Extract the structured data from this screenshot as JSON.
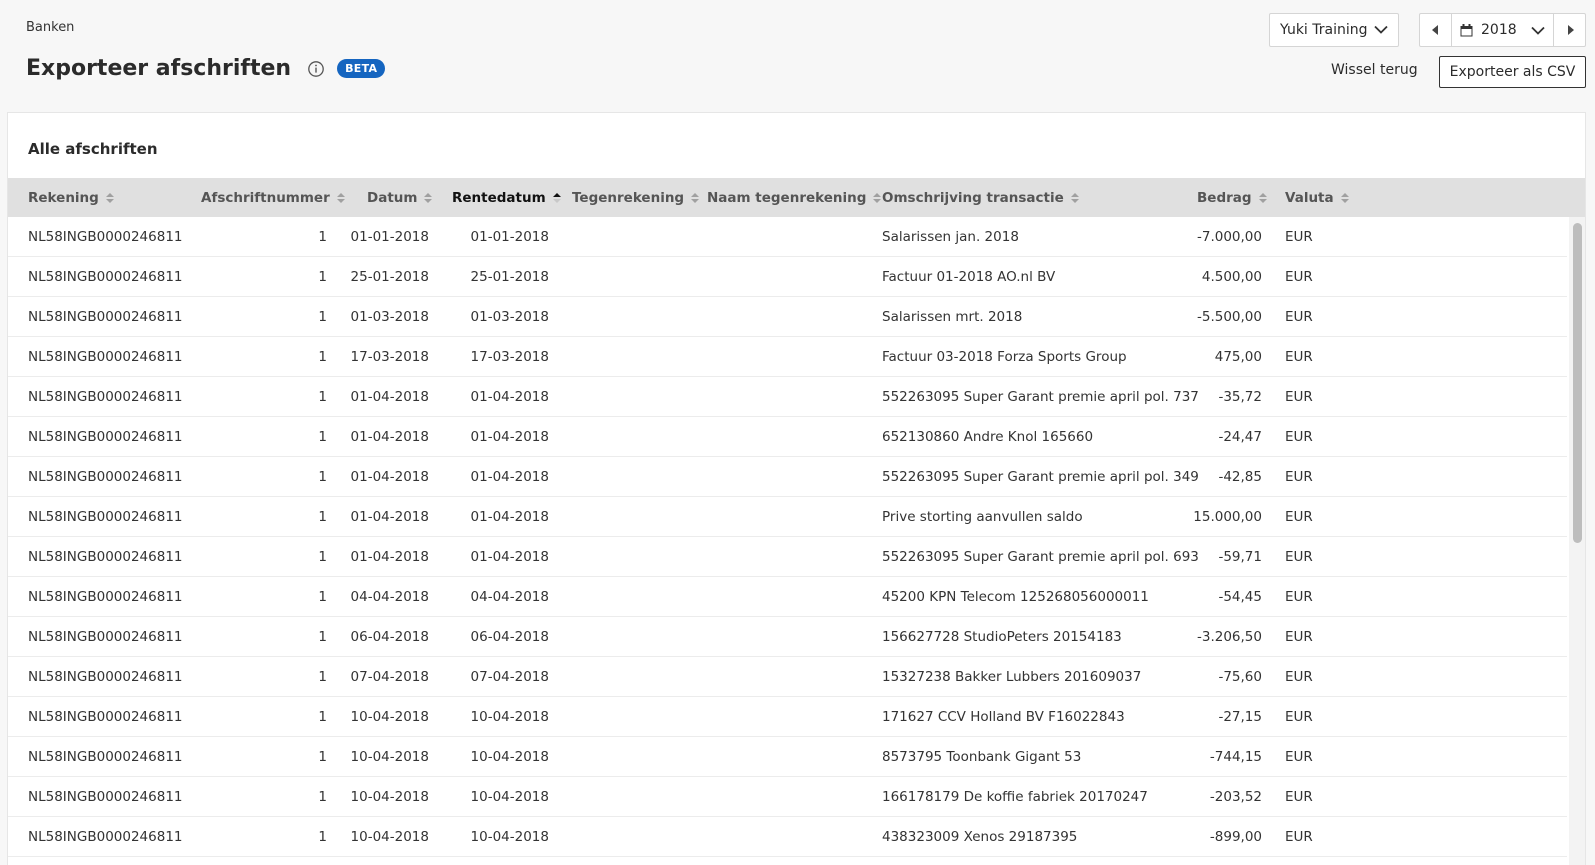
{
  "breadcrumb": "Banken",
  "title": "Exporteer afschriften",
  "beta_label": "BETA",
  "administration": "Yuki Training",
  "year": "2018",
  "switch_back_label": "Wissel terug",
  "export_label": "Exporteer als CSV",
  "panel_title": "Alle afschriften",
  "columns": [
    "Rekening",
    "Afschriftnummer",
    "Datum",
    "Rentedatum",
    "Tegenrekening",
    "Naam tegenrekening",
    "Omschrijving transactie",
    "Bedrag",
    "Valuta"
  ],
  "sorted_column": "Rentedatum",
  "sort_direction": "ascending",
  "colors": {
    "accent": "#1565c0",
    "header_bg": "#e0e0e0"
  },
  "rows": [
    [
      "NL58INGB0000246811",
      "1",
      "01-01-2018",
      "01-01-2018",
      "",
      "",
      "Salarissen jan. 2018",
      "-7.000,00",
      "EUR"
    ],
    [
      "NL58INGB0000246811",
      "1",
      "25-01-2018",
      "25-01-2018",
      "",
      "",
      "Factuur 01-2018 AO.nl BV",
      "4.500,00",
      "EUR"
    ],
    [
      "NL58INGB0000246811",
      "1",
      "01-03-2018",
      "01-03-2018",
      "",
      "",
      "Salarissen mrt. 2018",
      "-5.500,00",
      "EUR"
    ],
    [
      "NL58INGB0000246811",
      "1",
      "17-03-2018",
      "17-03-2018",
      "",
      "",
      "Factuur 03-2018 Forza Sports Group",
      "475,00",
      "EUR"
    ],
    [
      "NL58INGB0000246811",
      "1",
      "01-04-2018",
      "01-04-2018",
      "",
      "",
      "552263095 Super Garant premie april pol. 737",
      "-35,72",
      "EUR"
    ],
    [
      "NL58INGB0000246811",
      "1",
      "01-04-2018",
      "01-04-2018",
      "",
      "",
      "652130860 Andre Knol 165660",
      "-24,47",
      "EUR"
    ],
    [
      "NL58INGB0000246811",
      "1",
      "01-04-2018",
      "01-04-2018",
      "",
      "",
      "552263095 Super Garant premie april pol. 349",
      "-42,85",
      "EUR"
    ],
    [
      "NL58INGB0000246811",
      "1",
      "01-04-2018",
      "01-04-2018",
      "",
      "",
      "Prive storting aanvullen saldo",
      "15.000,00",
      "EUR"
    ],
    [
      "NL58INGB0000246811",
      "1",
      "01-04-2018",
      "01-04-2018",
      "",
      "",
      "552263095 Super Garant premie april pol. 693",
      "-59,71",
      "EUR"
    ],
    [
      "NL58INGB0000246811",
      "1",
      "04-04-2018",
      "04-04-2018",
      "",
      "",
      "45200 KPN Telecom 125268056000011",
      "-54,45",
      "EUR"
    ],
    [
      "NL58INGB0000246811",
      "1",
      "06-04-2018",
      "06-04-2018",
      "",
      "",
      "156627728 StudioPeters 20154183",
      "-3.206,50",
      "EUR"
    ],
    [
      "NL58INGB0000246811",
      "1",
      "07-04-2018",
      "07-04-2018",
      "",
      "",
      "15327238 Bakker Lubbers 201609037",
      "-75,60",
      "EUR"
    ],
    [
      "NL58INGB0000246811",
      "1",
      "10-04-2018",
      "10-04-2018",
      "",
      "",
      "171627 CCV Holland BV F16022843",
      "-27,15",
      "EUR"
    ],
    [
      "NL58INGB0000246811",
      "1",
      "10-04-2018",
      "10-04-2018",
      "",
      "",
      "8573795 Toonbank Gigant 53",
      "-744,15",
      "EUR"
    ],
    [
      "NL58INGB0000246811",
      "1",
      "10-04-2018",
      "10-04-2018",
      "",
      "",
      "166178179 De koffie fabriek 20170247",
      "-203,52",
      "EUR"
    ],
    [
      "NL58INGB0000246811",
      "1",
      "10-04-2018",
      "10-04-2018",
      "",
      "",
      "438323009 Xenos 29187395",
      "-899,00",
      "EUR"
    ]
  ]
}
